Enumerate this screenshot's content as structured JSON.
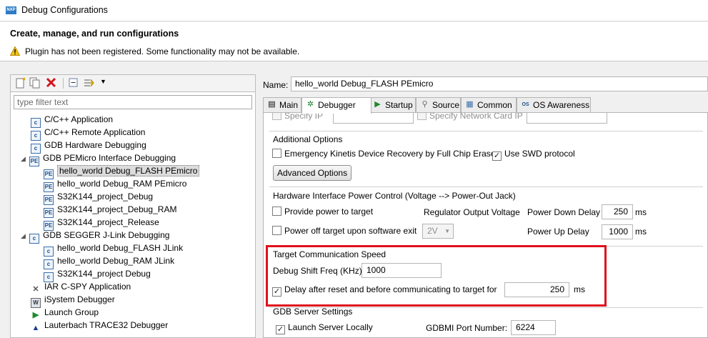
{
  "window": {
    "logo": "NXP",
    "title": "Debug Configurations"
  },
  "header": {
    "title": "Create, manage, and run configurations",
    "warning": "Plugin has not been registered. Some functionality may not be available."
  },
  "left": {
    "toolbar_icons": [
      "new-config-icon",
      "duplicate-icon",
      "delete-icon",
      "collapse-all-icon",
      "filter-icon",
      "dropdown-arrow-icon"
    ],
    "filter_placeholder": "type filter text",
    "tree": [
      {
        "label": "C/C++ Application",
        "level": 1,
        "icon": "c-icon"
      },
      {
        "label": "C/C++ Remote Application",
        "level": 1,
        "icon": "c-icon"
      },
      {
        "label": "GDB Hardware Debugging",
        "level": 1,
        "icon": "c-icon"
      },
      {
        "label": "GDB PEMicro Interface Debugging",
        "level": 0,
        "icon": "pe-icon",
        "expanded": true
      },
      {
        "label": "hello_world Debug_FLASH PEmicro",
        "level": 2,
        "icon": "pe-icon",
        "selected": true
      },
      {
        "label": "hello_world Debug_RAM PEmicro",
        "level": 2,
        "icon": "pe-icon"
      },
      {
        "label": "S32K144_project_Debug",
        "level": 2,
        "icon": "pe-icon"
      },
      {
        "label": "S32K144_project_Debug_RAM",
        "level": 2,
        "icon": "pe-icon"
      },
      {
        "label": "S32K144_project_Release",
        "level": 2,
        "icon": "pe-icon"
      },
      {
        "label": "GDB SEGGER J-Link Debugging",
        "level": 0,
        "icon": "c-icon",
        "expanded": true
      },
      {
        "label": "hello_world Debug_FLASH JLink",
        "level": 2,
        "icon": "c-icon"
      },
      {
        "label": "hello_world Debug_RAM JLink",
        "level": 2,
        "icon": "c-icon"
      },
      {
        "label": "S32K144_project Debug",
        "level": 2,
        "icon": "c-icon"
      },
      {
        "label": "IAR C-SPY Application",
        "level": 1,
        "icon": "iar-icon"
      },
      {
        "label": "iSystem Debugger",
        "level": 1,
        "icon": "isystem-icon"
      },
      {
        "label": "Launch Group",
        "level": 1,
        "icon": "launch-group-icon"
      },
      {
        "label": "Lauterbach TRACE32 Debugger",
        "level": 1,
        "icon": "lauterbach-icon"
      }
    ]
  },
  "right": {
    "name_label": "Name:",
    "name_value": "hello_world Debug_FLASH PEmicro",
    "tabs": [
      "Main",
      "Debugger",
      "Startup",
      "Source",
      "Common",
      "OS Awareness"
    ],
    "active_tab": "Debugger",
    "top_cut": {
      "specify_ip": "Specify IP",
      "specify_card_ip": "Specify Network Card IP"
    },
    "additional": {
      "title": "Additional Options",
      "emergency": "Emergency Kinetis Device Recovery by Full Chip Erase",
      "swd": "Use SWD protocol",
      "advanced_button": "Advanced Options"
    },
    "power": {
      "title": "Hardware Interface Power Control (Voltage --> Power-Out Jack)",
      "provide": "Provide power to target",
      "regulator": "Regulator Output Voltage",
      "down_label": "Power Down Delay",
      "down_value": "250",
      "down_unit": "ms",
      "off": "Power off target upon software exit",
      "voltage": "2V",
      "up_label": "Power Up Delay",
      "up_value": "1000",
      "up_unit": "ms"
    },
    "speed": {
      "title": "Target Communication Speed",
      "freq_label": "Debug Shift Freq (KHz)",
      "freq_value": "1000",
      "delay_label": "Delay after reset and before communicating to target for",
      "delay_value": "250",
      "delay_unit": "ms"
    },
    "gdb": {
      "title": "GDB Server Settings",
      "launch": "Launch Server Locally",
      "port_label": "GDBMI Port Number:",
      "port_value": "6224"
    }
  },
  "colors": {
    "highlight": "#e0101c",
    "accent": "#2e7bc4"
  }
}
